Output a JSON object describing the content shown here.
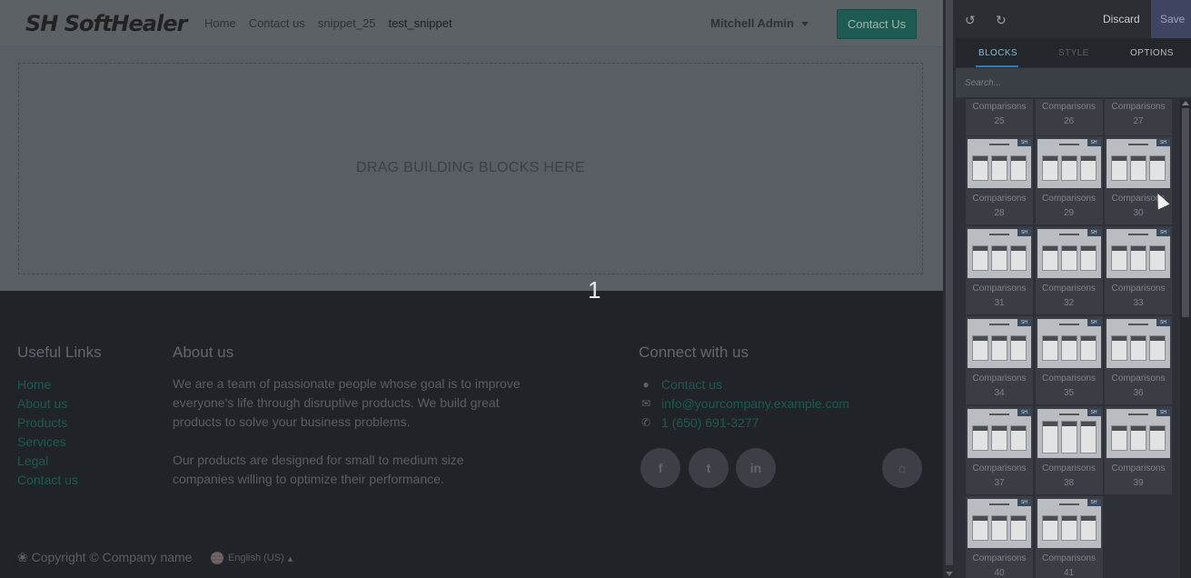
{
  "navbar": {
    "logo": "SH SoftHealer",
    "links": [
      "Home",
      "Contact us",
      "snippet_25",
      "test_snippet"
    ],
    "user": "Mitchell Admin",
    "cta": "Contact Us"
  },
  "dropzone": {
    "text": "DRAG BUILDING BLOCKS HERE"
  },
  "footer": {
    "marker": "1",
    "useful_links": {
      "heading": "Useful Links",
      "items": [
        "Home",
        "About us",
        "Products",
        "Services",
        "Legal",
        "Contact us"
      ]
    },
    "about": {
      "heading": "About us",
      "p1": "We are a team of passionate people whose goal is to improve everyone's life through disruptive products. We build great products to solve your business problems.",
      "p2": "Our products are designed for small to medium size companies willing to optimize their performance."
    },
    "connect": {
      "heading": "Connect with us",
      "contact": "Contact us",
      "email": "info@yourcompany.example.com",
      "phone": "1 (650) 691-3277"
    },
    "social": [
      "f",
      "t",
      "in"
    ],
    "copyright": "Copyright © Company name",
    "language": "English (US)"
  },
  "panel": {
    "discard": "Discard",
    "save": "Save",
    "tabs": [
      "BLOCKS",
      "STYLE",
      "OPTIONS"
    ],
    "search_placeholder": "Search...",
    "snippets": [
      {
        "name": "Comparisons",
        "num": "25"
      },
      {
        "name": "Comparisons",
        "num": "26"
      },
      {
        "name": "Comparisons",
        "num": "27"
      },
      {
        "name": "Comparisons",
        "num": "28"
      },
      {
        "name": "Comparisons",
        "num": "29"
      },
      {
        "name": "Comparisons",
        "num": "30"
      },
      {
        "name": "Comparisons",
        "num": "31"
      },
      {
        "name": "Comparisons",
        "num": "32"
      },
      {
        "name": "Comparisons",
        "num": "33"
      },
      {
        "name": "Comparisons",
        "num": "34"
      },
      {
        "name": "Comparisons",
        "num": "35"
      },
      {
        "name": "Comparisons",
        "num": "36"
      },
      {
        "name": "Comparisons",
        "num": "37"
      },
      {
        "name": "Comparisons",
        "num": "38"
      },
      {
        "name": "Comparisons",
        "num": "39"
      },
      {
        "name": "Comparisons",
        "num": "40"
      },
      {
        "name": "Comparisons",
        "num": "41"
      }
    ],
    "badge": "SH"
  },
  "colors": {
    "accent": "#1d5a52",
    "tab_active": "#2c7bb8",
    "save_bg": "#3e4560"
  }
}
